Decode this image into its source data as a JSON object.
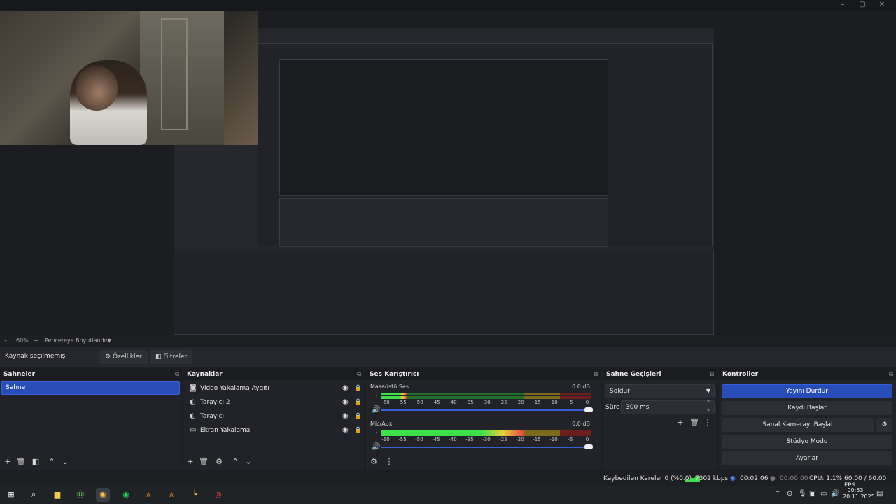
{
  "window": {
    "controls": [
      "–",
      "▢",
      "✕"
    ]
  },
  "zoom": {
    "minus": "–",
    "value": "60%",
    "plus": "+",
    "fit_label": "Pencereye Boyutlandır",
    "caret": "▼"
  },
  "source_bar": {
    "status": "Kaynak seçilmemiş",
    "properties": "Özellikler",
    "filters": "Filtreler"
  },
  "scenes": {
    "title": "Sahneler",
    "items": [
      "Sahne"
    ]
  },
  "sources": {
    "title": "Kaynaklar",
    "items": [
      {
        "label": "Video Yakalama Aygıtı",
        "icon": "camera-icon"
      },
      {
        "label": "Tarayıcı 2",
        "icon": "globe-icon"
      },
      {
        "label": "Tarayıcı",
        "icon": "globe-icon"
      },
      {
        "label": "Ekran Yakalama",
        "icon": "monitor-icon"
      }
    ]
  },
  "mixer": {
    "title": "Ses Karıştırıcı",
    "scale": [
      "-60",
      "-55",
      "-50",
      "-45",
      "-40",
      "-35",
      "-30",
      "-25",
      "-20",
      "-15",
      "-10",
      "-5",
      "0"
    ],
    "channels": [
      {
        "name": "Masaüstü Ses",
        "db": "0.0 dB",
        "level_pct": 12
      },
      {
        "name": "Mic/Aux",
        "db": "0.0 dB",
        "level_pct": 68
      }
    ]
  },
  "transitions": {
    "title": "Sahne Geçişleri",
    "type": "Soldur",
    "duration_label": "Süre",
    "duration_value": "300 ms"
  },
  "controls": {
    "title": "Kontroller",
    "stop_stream": "Yayını Durdur",
    "start_recording": "Kaydı Başlat",
    "start_vcam": "Sanal Kamerayı Başlat",
    "studio_mode": "Stüdyo Modu",
    "settings": "Ayarlar"
  },
  "status": {
    "dropped": "Kaybedilen Kareler 0 (%0.0)",
    "bitrate": "7302 kbps",
    "stream_time": "00:02:06",
    "record_time": "00:00:00",
    "cpu": "CPU: 1.1%",
    "fps": "60.00 / 60.00 FPS"
  },
  "taskbar": {
    "time": "00:53",
    "date": "20.11.2025"
  },
  "colors": {
    "accent": "#284cb8",
    "meter_green": "#3ee04a",
    "meter_yellow": "#e6d13b",
    "meter_red": "#e64040"
  }
}
